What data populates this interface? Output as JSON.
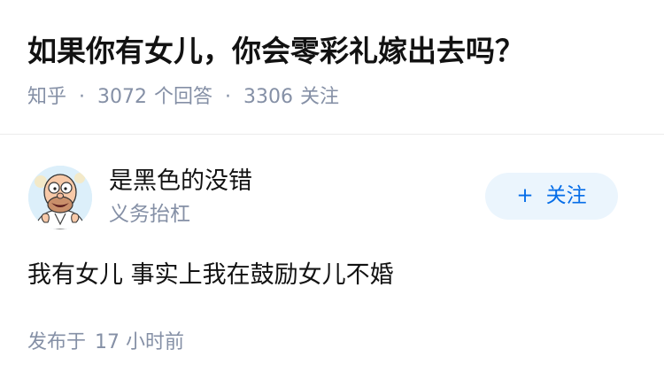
{
  "question": {
    "title": "如果你有女儿，你会零彩礼嫁出去吗？",
    "source": "知乎",
    "separator": "·",
    "answer_count": "3072",
    "answer_label": "个回答",
    "follower_count": "3306",
    "follower_label": "关注"
  },
  "answer": {
    "author": {
      "name": "是黑色的没错",
      "headline": "义务抬杠",
      "avatar_icon": "cartoon-avatar-icon"
    },
    "follow_button": {
      "plus": "+",
      "label": "关注"
    },
    "content": "我有女儿 事实上我在鼓励女儿不婚",
    "published": {
      "label": "发布于",
      "time": "17 小时前"
    }
  },
  "colors": {
    "text_primary": "#121212",
    "text_secondary": "#8590a6",
    "accent": "#056de8",
    "accent_bg": "#ebf5fd",
    "divider": "#ececec"
  }
}
